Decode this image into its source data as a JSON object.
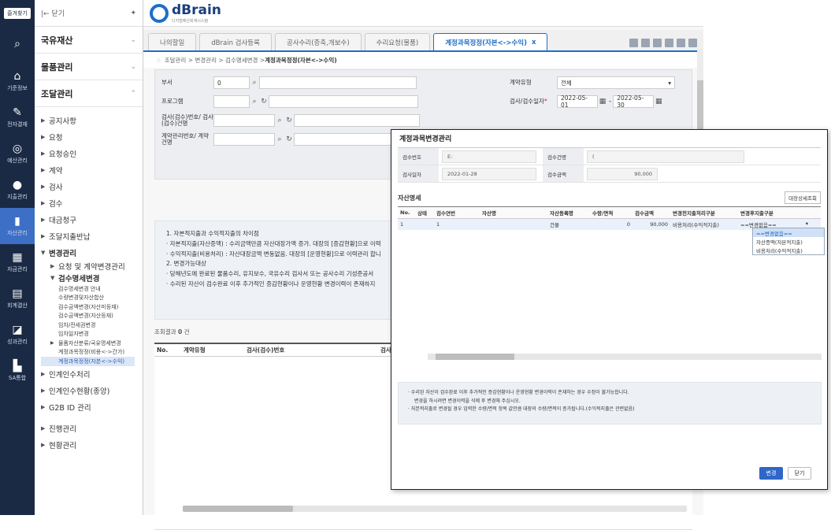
{
  "rail": {
    "top_label": "즐겨찾기",
    "items": [
      {
        "label": "",
        "icon": "search-icon",
        "glyph": "⌕"
      },
      {
        "label": "기준정보",
        "icon": "home-icon",
        "glyph": "⌂"
      },
      {
        "label": "전자결재",
        "icon": "pen-icon",
        "glyph": "✎"
      },
      {
        "label": "예산관리",
        "icon": "coins-icon",
        "glyph": "◎"
      },
      {
        "label": "지출관리",
        "icon": "money-icon",
        "glyph": "●"
      },
      {
        "label": "자산관리",
        "icon": "building-icon",
        "glyph": "▮"
      },
      {
        "label": "자금관리",
        "icon": "bank-icon",
        "glyph": "▦"
      },
      {
        "label": "회계결산",
        "icon": "report-icon",
        "glyph": "▤"
      },
      {
        "label": "성과관리",
        "icon": "chart-icon",
        "glyph": "◪"
      },
      {
        "label": "SA통합",
        "icon": "box-icon",
        "glyph": "▙"
      }
    ]
  },
  "menu": {
    "collapse_label": "|← 닫기",
    "sections": [
      {
        "label": "국유재산",
        "chev": "⌄"
      },
      {
        "label": "물품관리",
        "chev": "⌄"
      },
      {
        "label": "조달관리",
        "chev": "⌃"
      }
    ],
    "items_top": [
      "공지사항",
      "요청",
      "요청승인",
      "계약",
      "검사",
      "검수",
      "대금청구",
      "조달지출반납"
    ],
    "change_mgmt": "변경관리",
    "change_sub": [
      "요청 및 계약변경관리"
    ],
    "inspect_detail": "검수명세변경",
    "leaves": [
      "검수명세변경 안내",
      "수량변경및자산합산",
      "검수금액변경(자산미등재)",
      "검수금액변경(자산등재)",
      "임차/전세권변경",
      "임차일자변경"
    ],
    "subleaf": "물품자산분류/국유명세변경",
    "leaves2": [
      "계정과목정정(비용<->간가)",
      "계정과목정정(자본<->수익)"
    ],
    "items_bottom": [
      "인계인수처리",
      "인계인수현황(종앙)",
      "G2B ID 관리"
    ],
    "items_bottom2": [
      "진행관리",
      "현황관리"
    ]
  },
  "header": {
    "brand": "dBrain",
    "brand_sub": "디지털예산회계시스템"
  },
  "tabs": [
    {
      "label": "나의할일"
    },
    {
      "label": "dBrain 검사등록"
    },
    {
      "label": "공사수리(증축,개보수)"
    },
    {
      "label": "수리요청(물품)"
    },
    {
      "label": "계정과목정정(자본<->수익)",
      "close": "x"
    }
  ],
  "breadcrumb": {
    "star": "☆",
    "path": "조달관리 > 변경관리 > 검수명세변경 > ",
    "current": "계정과목정정(자본<->수익)"
  },
  "search": {
    "dept_label": "부서",
    "dept_val": "0",
    "program_label": "프로그램",
    "inspect_label": "검사(검수)번호/ 검사(검수)건명",
    "contract_label": "계약관리번호/ 계약건명",
    "contract_type_label": "계약유형",
    "contract_type_val": "전체",
    "date_label": "검사/검수일자",
    "date_from": "2022-05-01",
    "date_to": "2022-05-30"
  },
  "info": {
    "line1": "1. 자본적지출과 수익적지출의 차이점",
    "line2": "· 자본적지출(자산증액) : 수리금액만큼 자산대장가액 증가. 대장의 [증감현황]으로 이력",
    "line3": "· 수익적지출(비용처리) : 자산대장금액 변동없음. 대장의 [운영현황]으로 이력관리 합니",
    "line4": "2. 변경가능대상",
    "line5": "· 당해년도에 완료된 물품수리, 유지보수, 국유수리 검사서 또는 공사수리 기성준공서",
    "line6": "· 수리된 자산이 검수완료 이후 추가적인 증감현황이나 운영현황 변경이력이 존재하지"
  },
  "result": {
    "label": "조회결과",
    "count": "0",
    "unit": "건"
  },
  "grid": {
    "columns": [
      "No.",
      "계약유형",
      "검사(검수)번호",
      "검사(검수"
    ]
  },
  "popup": {
    "title": "계정과목변경관리",
    "f1_label": "검수번호",
    "f1_val": "E:",
    "f2_label": "검수건명",
    "f2_val": "(",
    "f3_label": "검사일자",
    "f3_val": "2022-01-28",
    "f4_label": "검수금액",
    "f4_val": "90,000",
    "asset_title": "자산명세",
    "detail_btn": "대장상세조회",
    "columns": [
      "No.",
      "상태",
      "검수연번",
      "자산명",
      "자산등록명",
      "수량/면적",
      "검수금액",
      "변경전지출처리구분",
      "변경후지출구분"
    ],
    "row": [
      "1",
      "",
      "1",
      "",
      "건물",
      "0",
      "90,000",
      "비용처리(수익적지출)",
      "==변경없음=="
    ],
    "dropdown": [
      "==변경없음==",
      "자산증액(자본적지출)",
      "비용처리(수익적지출)"
    ],
    "note1": "· 수리된 자산이 검수완료 이후 추가적인 증감현황이나 운영현황 변경이력이 존재하는 경우 수정이 불가능합니다.",
    "note2": "변경을 하시려면 변경이력을 삭제 후 변경해 주십시오.",
    "note3": "· 자본적지출로 변경될 경우 입력한 수량/면적 항목 값만큼 대장의 수량/면적이 증가됩니다.(수익적지출은 관련없음)",
    "btn_change": "변경",
    "btn_close": "닫기"
  }
}
